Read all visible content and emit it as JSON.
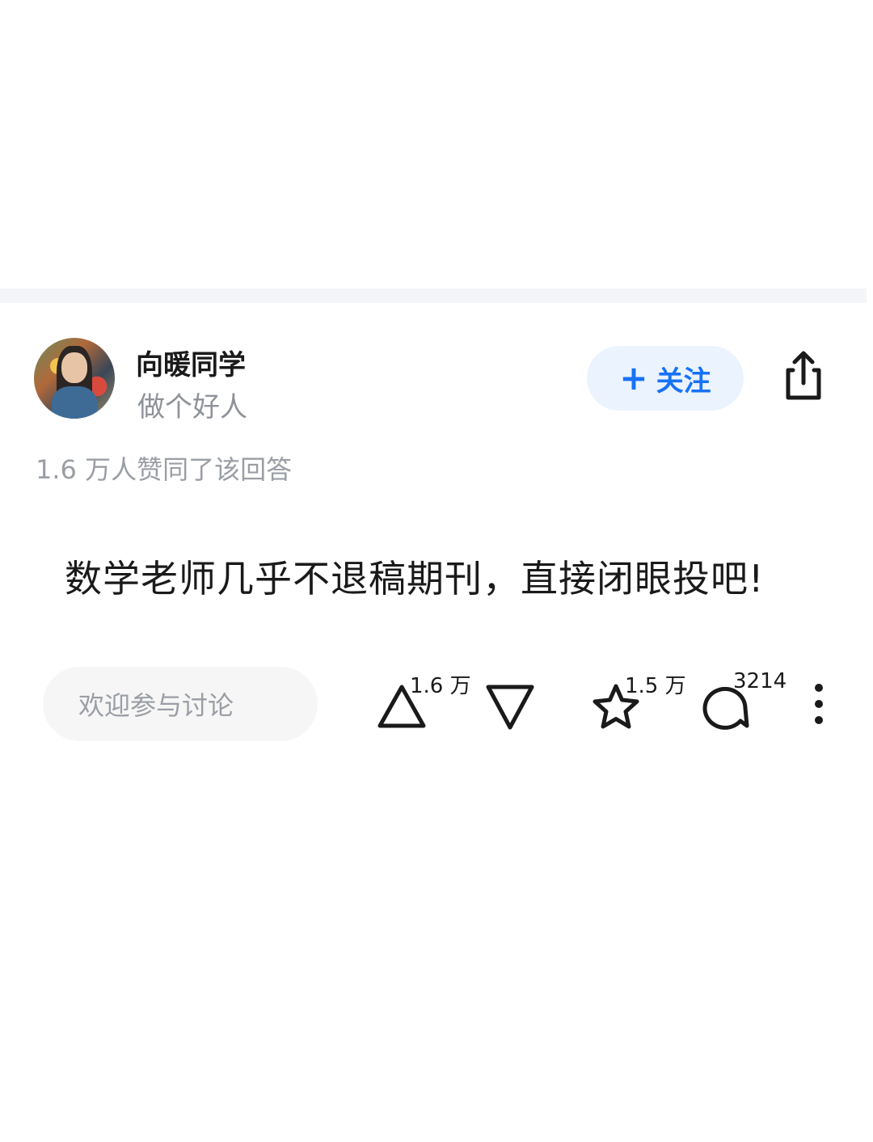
{
  "author": {
    "name": "向暖同学",
    "tagline": "做个好人"
  },
  "follow": {
    "icon": "plus-icon",
    "plus": "+",
    "label": "关注"
  },
  "share": {
    "icon": "share-icon"
  },
  "approval_text": "1.6 万人赞同了该回答",
  "answer": {
    "text": "数学老师几乎不退稿期刊，直接闭眼投吧!"
  },
  "bottom_bar": {
    "comment_placeholder": "欢迎参与讨论",
    "upvote_count": "1.6 万",
    "favorite_count": "1.5 万",
    "comment_count": "3214",
    "icons": [
      "upvote-icon",
      "downvote-icon",
      "star-icon",
      "comment-icon",
      "more-icon"
    ]
  },
  "colors": {
    "accent": "#1772f6",
    "follow_bg": "#ebf3ff",
    "muted_text": "#9a9ea4",
    "divider": "#f4f5f8"
  }
}
